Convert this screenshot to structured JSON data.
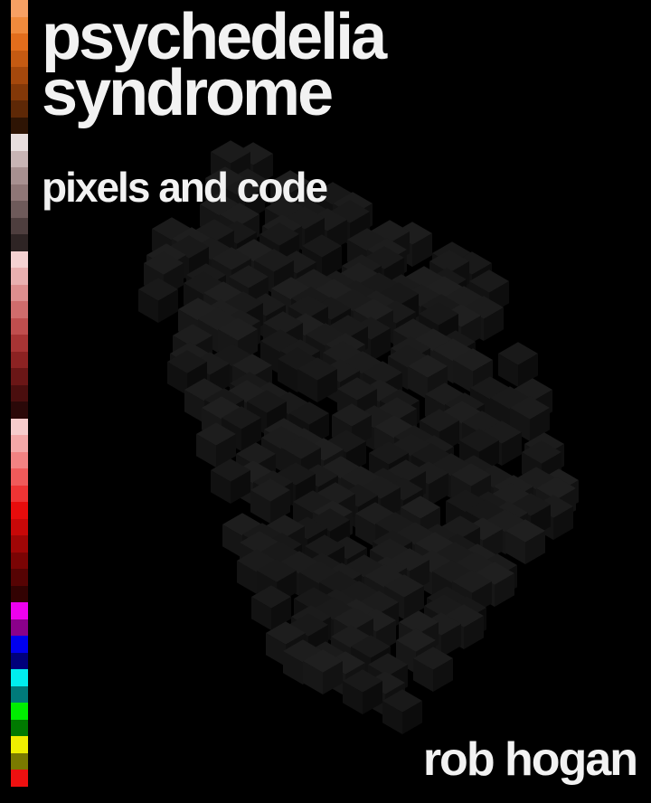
{
  "cover": {
    "title_line1": "psychedelia",
    "title_line2": "syndrome",
    "subtitle": "pixels and code",
    "author": "rob hogan"
  },
  "palette": [
    "#f7a063",
    "#f08a3c",
    "#e26d1c",
    "#c55a12",
    "#a5480c",
    "#833808",
    "#5e2806",
    "#2e1404",
    "#e8dede",
    "#c8b4b4",
    "#a89090",
    "#8f7676",
    "#6e5a5a",
    "#4e3e3e",
    "#2e2424",
    "#f5d2d2",
    "#eab0b0",
    "#de8e8e",
    "#d06c6c",
    "#c04e4e",
    "#a83434",
    "#8c2222",
    "#6a1616",
    "#4a0e0e",
    "#2a0808",
    "#f7cccc",
    "#f4a8a8",
    "#f28282",
    "#f05a5a",
    "#ee3434",
    "#e80c0c",
    "#c80808",
    "#a00606",
    "#7a0404",
    "#560303",
    "#320202",
    "#ee00ee",
    "#8a008a",
    "#0000ee",
    "#00007a",
    "#00eeee",
    "#007a7a",
    "#00ee00",
    "#007a00",
    "#eeee00",
    "#7a7a00",
    "#ee1010"
  ],
  "colors": {
    "background": "#000000",
    "text": "#f2f2f2",
    "cube": "#1a1a1a"
  }
}
